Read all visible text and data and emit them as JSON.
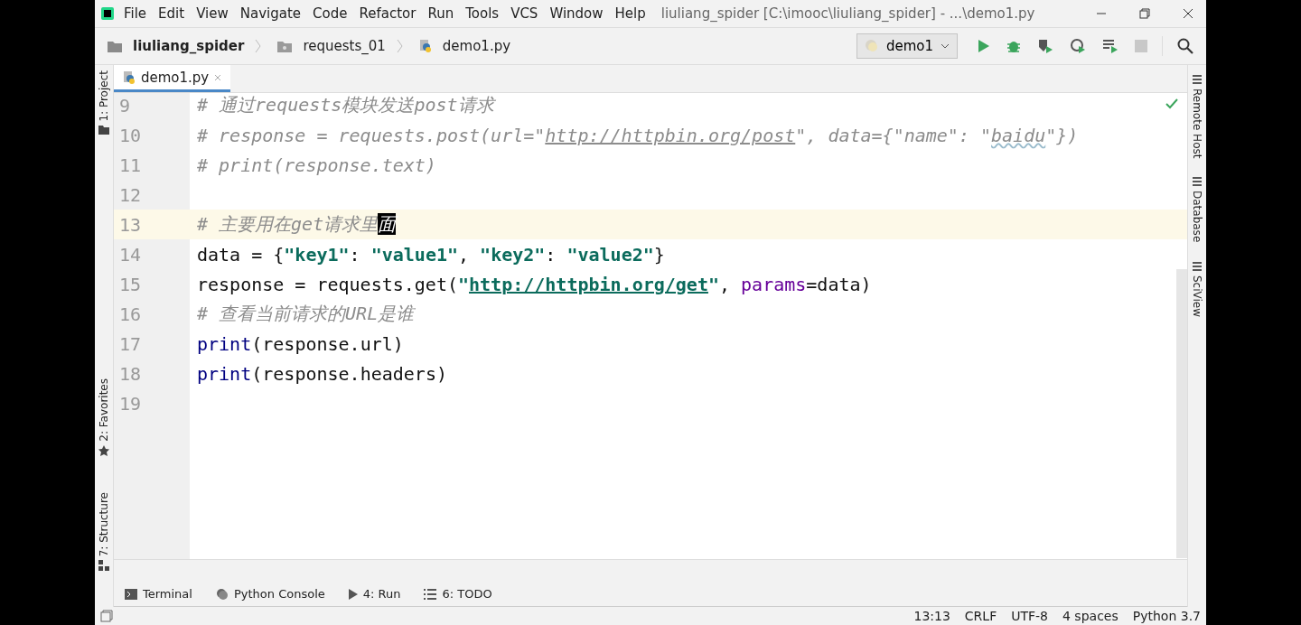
{
  "window": {
    "menu": [
      "File",
      "Edit",
      "View",
      "Navigate",
      "Code",
      "Refactor",
      "Run",
      "Tools",
      "VCS",
      "Window",
      "Help"
    ],
    "title": "liuliang_spider [C:\\imooc\\liuliang_spider] - ...\\demo1.py"
  },
  "breadcrumbs": [
    {
      "label": "liuliang_spider",
      "kind": "project"
    },
    {
      "label": "requests_01",
      "kind": "folder"
    },
    {
      "label": "demo1.py",
      "kind": "file"
    }
  ],
  "run_config": "demo1",
  "left_tools_top": [
    {
      "label": "1: Project",
      "kind": "project"
    }
  ],
  "left_tools_bottom": [
    {
      "label": "2: Favorites",
      "kind": "favorites"
    },
    {
      "label": "7: Structure",
      "kind": "structure"
    }
  ],
  "right_tools": [
    "Remote Host",
    "Database",
    "SciView"
  ],
  "editor_tabs": [
    {
      "label": "demo1.py",
      "selected": true
    }
  ],
  "code": [
    {
      "number": "9",
      "current": false,
      "tokens": [
        {
          "kind": "comment",
          "text": "# 通过requests模块发送post请求"
        }
      ]
    },
    {
      "number": "10",
      "current": false,
      "tokens": [
        {
          "kind": "comment",
          "text": "# response = requests.post(url=\""
        },
        {
          "kind": "comment-url",
          "text": "http://httpbin.org/post"
        },
        {
          "kind": "comment",
          "text": "\", data={\"name\": \""
        },
        {
          "kind": "comment-typo",
          "text": "baidu"
        },
        {
          "kind": "comment",
          "text": "\"})"
        }
      ]
    },
    {
      "number": "11",
      "current": false,
      "tokens": [
        {
          "kind": "comment",
          "text": "# print(response.text)"
        }
      ]
    },
    {
      "number": "12",
      "current": false
    },
    {
      "number": "13",
      "current": true,
      "tokens": [
        {
          "kind": "comment",
          "text": "# 主要用在get请求里"
        },
        {
          "kind": "selection",
          "text": "面"
        }
      ]
    },
    {
      "number": "14",
      "current": false,
      "tokens": [
        {
          "kind": "plain",
          "text": "data = {"
        },
        {
          "kind": "string",
          "text": "\"key1\""
        },
        {
          "kind": "plain",
          "text": ": "
        },
        {
          "kind": "string",
          "text": "\"value1\""
        },
        {
          "kind": "plain",
          "text": ", "
        },
        {
          "kind": "string",
          "text": "\"key2\""
        },
        {
          "kind": "plain",
          "text": ": "
        },
        {
          "kind": "string",
          "text": "\"value2\""
        },
        {
          "kind": "plain",
          "text": "}"
        }
      ]
    },
    {
      "number": "15",
      "current": false,
      "tokens": [
        {
          "kind": "plain",
          "text": "response = requests.get("
        },
        {
          "kind": "string",
          "text": "\""
        },
        {
          "kind": "url",
          "text": "http://httpbin.org/get"
        },
        {
          "kind": "string",
          "text": "\""
        },
        {
          "kind": "plain",
          "text": ", "
        },
        {
          "kind": "param",
          "text": "params"
        },
        {
          "kind": "plain",
          "text": "=data)"
        }
      ]
    },
    {
      "number": "16",
      "current": false,
      "tokens": [
        {
          "kind": "comment",
          "text": "# 查看当前请求的URL是谁"
        }
      ]
    },
    {
      "number": "17",
      "current": false,
      "tokens": [
        {
          "kind": "builtin",
          "text": "print"
        },
        {
          "kind": "plain",
          "text": "(response.url)"
        }
      ]
    },
    {
      "number": "18",
      "current": false,
      "tokens": [
        {
          "kind": "builtin",
          "text": "print"
        },
        {
          "kind": "plain",
          "text": "(response.headers)"
        }
      ]
    },
    {
      "number": "19",
      "current": false
    }
  ],
  "tool_windows": [
    {
      "label": "Terminal",
      "kind": "terminal"
    },
    {
      "label": "Python Console",
      "kind": "console"
    },
    {
      "label": "4: Run",
      "kind": "run"
    },
    {
      "label": "6: TODO",
      "kind": "todo"
    }
  ],
  "status_bar": [
    "13:13",
    "CRLF",
    "UTF-8",
    "4 spaces",
    "Python 3.7"
  ]
}
